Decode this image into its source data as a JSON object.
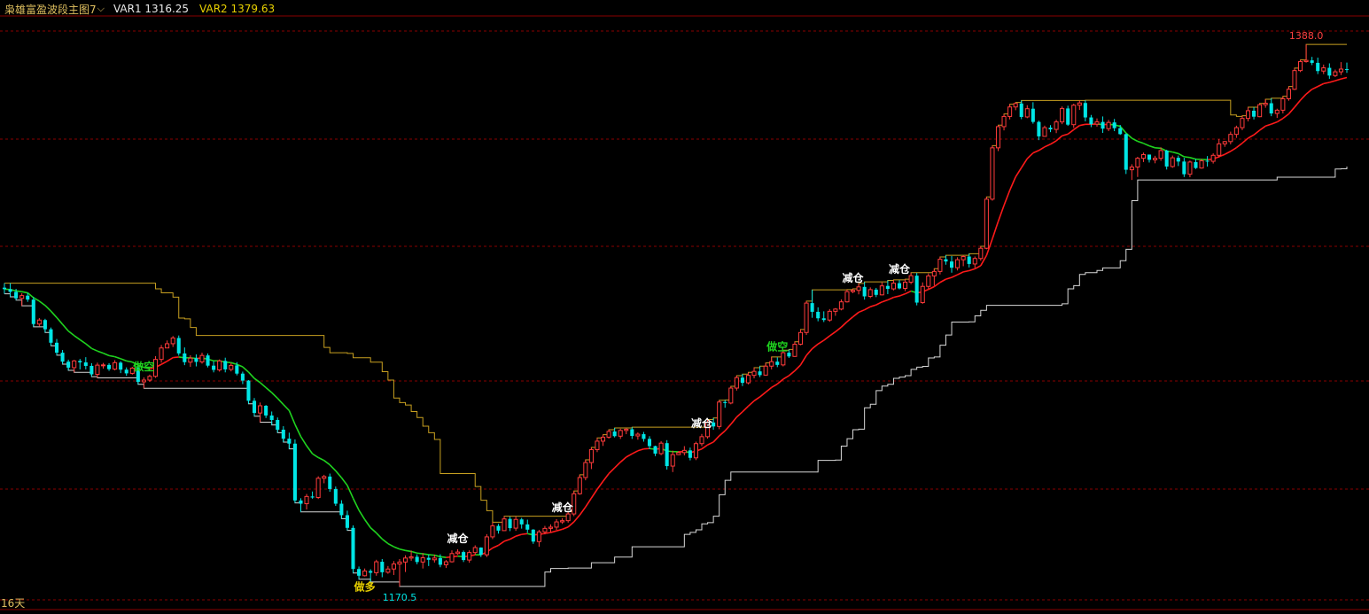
{
  "header": {
    "title": "枭雄富盈波段主图7",
    "chevron_icon": "chevron-down-icon",
    "var1_label": "VAR1 1316.25",
    "var2_label": "VAR2 1379.63"
  },
  "footer": {
    "period": "16天"
  },
  "colors": {
    "up": "#ff3b3b",
    "down": "#00e5e5",
    "ma": "#ff1a1a",
    "ma_green": "#1fd31f",
    "trail": "#c8a020",
    "support": "#d8d8d8",
    "grid": "#8a0000"
  },
  "chart_data": {
    "type": "candlestick",
    "y_range": [
      1163,
      1398
    ],
    "max_label": "1388.0",
    "min_label": "1170.5",
    "candles": [
      [
        1290.4,
        1292.2,
        1287.9,
        1289.8
      ],
      [
        1289.8,
        1292.2,
        1286.7,
        1288.7
      ],
      [
        1288.7,
        1289.9,
        1285.4,
        1286.1
      ],
      [
        1286.1,
        1288.2,
        1283.1,
        1287.2
      ],
      [
        1287.2,
        1288.3,
        1284.7,
        1285.6
      ],
      [
        1285.6,
        1286.6,
        1274.7,
        1275.8
      ],
      [
        1275.8,
        1278.2,
        1274.9,
        1277.4
      ],
      [
        1277.4,
        1277.9,
        1272.4,
        1273.7
      ],
      [
        1273.7,
        1274.4,
        1267.1,
        1268.3
      ],
      [
        1268.3,
        1269.8,
        1263.3,
        1264.3
      ],
      [
        1264.3,
        1265.4,
        1259.7,
        1260.7
      ],
      [
        1260.7,
        1261.5,
        1257.2,
        1258.3
      ],
      [
        1258.3,
        1261.4,
        1256.4,
        1261.0
      ],
      [
        1261.0,
        1261.8,
        1257.6,
        1260.4
      ],
      [
        1260.4,
        1262.5,
        1257.6,
        1259.0
      ],
      [
        1259.0,
        1260.1,
        1254.7,
        1255.6
      ],
      [
        1255.6,
        1260.3,
        1254.2,
        1259.3
      ],
      [
        1259.3,
        1260.2,
        1257.9,
        1259.4
      ],
      [
        1259.4,
        1260.1,
        1257.0,
        1257.7
      ],
      [
        1257.7,
        1261.3,
        1257.2,
        1260.3
      ],
      [
        1260.3,
        1260.9,
        1256.1,
        1257.5
      ],
      [
        1257.5,
        1258.4,
        1255.0,
        1256.0
      ],
      [
        1256.0,
        1258.6,
        1255.5,
        1258.1
      ],
      [
        1258.1,
        1259.0,
        1251.6,
        1252.6
      ],
      [
        1252.6,
        1254.4,
        1250.0,
        1253.3
      ],
      [
        1253.3,
        1255.5,
        1252.6,
        1254.8
      ],
      [
        1254.8,
        1262.9,
        1254.2,
        1261.6
      ],
      [
        1261.6,
        1267.4,
        1260.3,
        1266.2
      ],
      [
        1266.2,
        1269.2,
        1266.1,
        1267.9
      ],
      [
        1267.9,
        1271.0,
        1266.6,
        1270.2
      ],
      [
        1270.2,
        1271.2,
        1263.1,
        1264.0
      ],
      [
        1264.0,
        1266.4,
        1259.3,
        1260.5
      ],
      [
        1260.5,
        1263.3,
        1258.6,
        1262.1
      ],
      [
        1262.1,
        1263.6,
        1258.8,
        1260.6
      ],
      [
        1260.6,
        1264.3,
        1259.9,
        1263.2
      ],
      [
        1263.2,
        1264.0,
        1258.4,
        1259.1
      ],
      [
        1259.1,
        1260.9,
        1256.4,
        1257.4
      ],
      [
        1257.4,
        1261.6,
        1256.7,
        1261.0
      ],
      [
        1261.0,
        1262.3,
        1256.4,
        1257.6
      ],
      [
        1257.6,
        1260.2,
        1256.8,
        1259.2
      ],
      [
        1259.2,
        1260.5,
        1255.2,
        1255.9
      ],
      [
        1255.9,
        1256.7,
        1251.7,
        1253.1
      ],
      [
        1253.1,
        1253.3,
        1243.8,
        1245.0
      ],
      [
        1245.0,
        1246.1,
        1238.8,
        1240.1
      ],
      [
        1240.1,
        1244.3,
        1236.4,
        1243.0
      ],
      [
        1243.0,
        1243.3,
        1238.1,
        1239.1
      ],
      [
        1239.1,
        1240.7,
        1235.3,
        1237.3
      ],
      [
        1237.3,
        1238.3,
        1232.2,
        1233.4
      ],
      [
        1233.4,
        1234.8,
        1228.4,
        1229.8
      ],
      [
        1229.8,
        1232.2,
        1225.7,
        1227.8
      ],
      [
        1227.8,
        1229.5,
        1204.0,
        1205.0
      ],
      [
        1205.0,
        1205.9,
        1200.4,
        1203.7
      ],
      [
        1203.7,
        1207.6,
        1201.4,
        1206.6
      ],
      [
        1206.6,
        1208.6,
        1205.7,
        1206.2
      ],
      [
        1206.2,
        1214.7,
        1205.6,
        1213.9
      ],
      [
        1213.9,
        1215.3,
        1211.9,
        1214.6
      ],
      [
        1214.6,
        1215.8,
        1208.5,
        1209.6
      ],
      [
        1209.6,
        1210.6,
        1202.8,
        1203.7
      ],
      [
        1203.7,
        1205.1,
        1197.7,
        1199.1
      ],
      [
        1199.1,
        1200.9,
        1193.0,
        1194.0
      ],
      [
        1194.0,
        1195.0,
        1175.9,
        1177.5
      ],
      [
        1177.5,
        1178.5,
        1173.4,
        1174.8
      ],
      [
        1174.8,
        1177.7,
        1174.5,
        1176.7
      ],
      [
        1176.7,
        1177.4,
        1172.3,
        1176.0
      ],
      [
        1176.0,
        1181.2,
        1174.8,
        1180.4
      ],
      [
        1180.4,
        1181.5,
        1174.2,
        1176.2
      ],
      [
        1176.2,
        1178.7,
        1175.6,
        1177.5
      ],
      [
        1177.5,
        1180.7,
        1175.1,
        1179.5
      ],
      [
        1179.5,
        1181.5,
        1170.5,
        1180.3
      ],
      [
        1180.3,
        1183.0,
        1176.3,
        1181.9
      ],
      [
        1181.9,
        1184.9,
        1180.8,
        1182.4
      ],
      [
        1182.4,
        1183.4,
        1179.4,
        1180.3
      ],
      [
        1180.3,
        1183.9,
        1177.7,
        1182.0
      ],
      [
        1182.0,
        1183.3,
        1178.7,
        1181.2
      ],
      [
        1181.2,
        1183.3,
        1180.1,
        1181.9
      ],
      [
        1181.9,
        1183.4,
        1178.2,
        1179.2
      ],
      [
        1179.2,
        1181.1,
        1177.9,
        1180.4
      ],
      [
        1180.4,
        1185.0,
        1180.1,
        1183.7
      ],
      [
        1183.7,
        1185.4,
        1183.2,
        1184.3
      ],
      [
        1184.3,
        1184.9,
        1180.3,
        1181.1
      ],
      [
        1181.1,
        1185.0,
        1180.0,
        1184.1
      ],
      [
        1184.1,
        1187.0,
        1183.2,
        1186.1
      ],
      [
        1186.1,
        1186.2,
        1182.3,
        1183.2
      ],
      [
        1183.2,
        1191.5,
        1182.3,
        1190.4
      ],
      [
        1190.4,
        1196.3,
        1189.5,
        1194.8
      ],
      [
        1194.8,
        1195.6,
        1191.7,
        1192.9
      ],
      [
        1192.9,
        1198.7,
        1192.8,
        1197.6
      ],
      [
        1197.6,
        1198.5,
        1192.7,
        1193.9
      ],
      [
        1193.9,
        1198.6,
        1192.8,
        1197.4
      ],
      [
        1197.4,
        1198.0,
        1193.7,
        1195.4
      ],
      [
        1195.4,
        1197.3,
        1192.0,
        1193.3
      ],
      [
        1193.3,
        1193.5,
        1187.6,
        1188.5
      ],
      [
        1188.5,
        1193.2,
        1186.4,
        1192.4
      ],
      [
        1192.4,
        1194.8,
        1191.4,
        1193.8
      ],
      [
        1193.8,
        1195.4,
        1192.2,
        1194.3
      ],
      [
        1194.3,
        1197.5,
        1193.2,
        1196.4
      ],
      [
        1196.4,
        1197.9,
        1195.6,
        1196.9
      ],
      [
        1196.9,
        1200.5,
        1196.1,
        1199.6
      ],
      [
        1199.6,
        1208.8,
        1198.7,
        1207.7
      ],
      [
        1207.7,
        1215.3,
        1207.3,
        1214.2
      ],
      [
        1214.2,
        1221.3,
        1213.1,
        1220.2
      ],
      [
        1220.2,
        1226.3,
        1217.6,
        1225.4
      ],
      [
        1225.4,
        1230.1,
        1224.4,
        1228.8
      ],
      [
        1228.8,
        1231.4,
        1226.9,
        1230.4
      ],
      [
        1230.4,
        1233.4,
        1229.8,
        1232.7
      ],
      [
        1232.7,
        1234.1,
        1230.3,
        1230.8
      ],
      [
        1230.8,
        1233.8,
        1229.7,
        1233.1
      ],
      [
        1233.1,
        1233.9,
        1231.6,
        1233.6
      ],
      [
        1233.6,
        1234.4,
        1229.7,
        1230.9
      ],
      [
        1230.9,
        1232.3,
        1229.4,
        1231.6
      ],
      [
        1231.6,
        1232.5,
        1228.6,
        1229.7
      ],
      [
        1229.7,
        1230.8,
        1225.6,
        1226.8
      ],
      [
        1226.8,
        1227.0,
        1222.8,
        1223.8
      ],
      [
        1223.8,
        1228.8,
        1223.2,
        1228.0
      ],
      [
        1228.0,
        1229.2,
        1217.4,
        1218.8
      ],
      [
        1218.8,
        1225.0,
        1216.4,
        1223.4
      ],
      [
        1223.4,
        1224.7,
        1223.2,
        1224.2
      ],
      [
        1224.2,
        1226.8,
        1223.1,
        1225.1
      ],
      [
        1225.1,
        1226.2,
        1221.1,
        1222.1
      ],
      [
        1222.1,
        1228.6,
        1221.2,
        1227.8
      ],
      [
        1227.8,
        1231.7,
        1226.8,
        1230.6
      ],
      [
        1230.6,
        1237.5,
        1229.8,
        1236.3
      ],
      [
        1236.3,
        1238.1,
        1233.4,
        1234.7
      ],
      [
        1234.7,
        1245.2,
        1233.6,
        1244.5
      ],
      [
        1244.5,
        1245.3,
        1242.2,
        1244.1
      ],
      [
        1244.1,
        1250.8,
        1243.6,
        1250.1
      ],
      [
        1250.1,
        1255.1,
        1249.1,
        1254.3
      ],
      [
        1254.3,
        1255.7,
        1250.9,
        1252.2
      ],
      [
        1252.2,
        1256.4,
        1251.6,
        1255.2
      ],
      [
        1255.2,
        1258.3,
        1254.0,
        1256.8
      ],
      [
        1256.8,
        1258.9,
        1254.5,
        1255.3
      ],
      [
        1255.3,
        1260.2,
        1255.1,
        1258.9
      ],
      [
        1258.9,
        1262.6,
        1257.6,
        1260.7
      ],
      [
        1260.7,
        1262.4,
        1258.5,
        1259.4
      ],
      [
        1259.4,
        1265.3,
        1258.8,
        1264.3
      ],
      [
        1264.3,
        1265.6,
        1262.2,
        1262.8
      ],
      [
        1262.8,
        1268.7,
        1262.6,
        1267.7
      ],
      [
        1267.7,
        1273.6,
        1267.3,
        1272.4
      ],
      [
        1272.4,
        1285.0,
        1271.4,
        1284.2
      ],
      [
        1284.2,
        1289.5,
        1278.3,
        1280.7
      ],
      [
        1280.7,
        1282.5,
        1276.9,
        1278.1
      ],
      [
        1278.1,
        1280.9,
        1276.6,
        1277.4
      ],
      [
        1277.4,
        1281.8,
        1276.7,
        1280.9
      ],
      [
        1280.9,
        1282.2,
        1279.1,
        1281.8
      ],
      [
        1281.8,
        1285.7,
        1281.3,
        1284.7
      ],
      [
        1284.7,
        1289.6,
        1284.4,
        1288.8
      ],
      [
        1288.8,
        1289.9,
        1288.2,
        1289.3
      ],
      [
        1289.3,
        1292.1,
        1287.7,
        1290.7
      ],
      [
        1290.7,
        1292.7,
        1285.6,
        1286.9
      ],
      [
        1286.9,
        1290.5,
        1286.2,
        1289.6
      ],
      [
        1289.6,
        1290.3,
        1286.6,
        1287.5
      ],
      [
        1287.5,
        1292.5,
        1287.3,
        1291.1
      ],
      [
        1291.1,
        1293.3,
        1287.8,
        1289.9
      ],
      [
        1289.9,
        1293.5,
        1289.3,
        1292.2
      ],
      [
        1292.2,
        1293.4,
        1289.7,
        1290.1
      ],
      [
        1290.1,
        1293.8,
        1289.0,
        1292.6
      ],
      [
        1292.6,
        1296.4,
        1291.8,
        1295.2
      ],
      [
        1295.2,
        1296.3,
        1283.3,
        1284.4
      ],
      [
        1284.4,
        1292.5,
        1283.9,
        1290.9
      ],
      [
        1290.9,
        1296.1,
        1289.9,
        1295.1
      ],
      [
        1295.1,
        1298.0,
        1291.2,
        1296.9
      ],
      [
        1296.9,
        1302.7,
        1295.7,
        1301.8
      ],
      [
        1301.8,
        1303.4,
        1299.6,
        1300.9
      ],
      [
        1300.9,
        1303.1,
        1296.4,
        1298.4
      ],
      [
        1298.4,
        1302.6,
        1297.3,
        1301.6
      ],
      [
        1301.6,
        1303.4,
        1299.0,
        1302.9
      ],
      [
        1302.9,
        1304.0,
        1298.5,
        1299.9
      ],
      [
        1299.9,
        1302.9,
        1298.3,
        1302.1
      ],
      [
        1302.1,
        1307.0,
        1301.2,
        1306.2
      ],
      [
        1306.2,
        1326.8,
        1305.8,
        1325.9
      ],
      [
        1325.9,
        1347.4,
        1325.3,
        1346.5
      ],
      [
        1346.5,
        1355.6,
        1345.2,
        1355.0
      ],
      [
        1355.0,
        1360.1,
        1353.5,
        1359.1
      ],
      [
        1359.1,
        1364.0,
        1357.9,
        1362.9
      ],
      [
        1362.9,
        1364.7,
        1361.6,
        1364.3
      ],
      [
        1364.3,
        1365.5,
        1358.0,
        1358.9
      ],
      [
        1358.9,
        1363.6,
        1358.4,
        1362.2
      ],
      [
        1362.2,
        1364.8,
        1356.2,
        1356.9
      ],
      [
        1356.9,
        1357.4,
        1349.6,
        1351.1
      ],
      [
        1351.1,
        1355.4,
        1350.9,
        1354.6
      ],
      [
        1354.6,
        1355.6,
        1352.8,
        1353.9
      ],
      [
        1353.9,
        1357.8,
        1352.4,
        1356.9
      ],
      [
        1356.9,
        1363.1,
        1356.0,
        1362.3
      ],
      [
        1362.3,
        1363.4,
        1355.3,
        1355.8
      ],
      [
        1355.8,
        1364.2,
        1354.5,
        1363.6
      ],
      [
        1363.6,
        1365.5,
        1361.7,
        1364.5
      ],
      [
        1364.5,
        1365.6,
        1357.1,
        1358.7
      ],
      [
        1358.7,
        1359.7,
        1354.8,
        1356.0
      ],
      [
        1356.0,
        1358.3,
        1355.0,
        1356.9
      ],
      [
        1356.9,
        1359.1,
        1352.5,
        1354.2
      ],
      [
        1354.2,
        1357.7,
        1353.2,
        1356.7
      ],
      [
        1356.7,
        1358.1,
        1353.2,
        1354.4
      ],
      [
        1354.4,
        1355.7,
        1351.7,
        1352.0
      ],
      [
        1352.0,
        1352.3,
        1336.0,
        1337.7
      ],
      [
        1337.7,
        1339.9,
        1333.6,
        1338.8
      ],
      [
        1338.8,
        1342.9,
        1334.8,
        1342.3
      ],
      [
        1342.3,
        1344.6,
        1340.8,
        1343.8
      ],
      [
        1343.8,
        1343.8,
        1340.6,
        1341.7
      ],
      [
        1341.7,
        1343.3,
        1340.3,
        1342.3
      ],
      [
        1342.3,
        1346.7,
        1341.3,
        1345.4
      ],
      [
        1345.4,
        1345.7,
        1337.8,
        1339.0
      ],
      [
        1339.0,
        1343.4,
        1338.5,
        1342.5
      ],
      [
        1342.5,
        1343.4,
        1339.2,
        1341.0
      ],
      [
        1341.0,
        1342.5,
        1334.8,
        1335.9
      ],
      [
        1335.9,
        1341.4,
        1334.7,
        1340.8
      ],
      [
        1340.8,
        1342.0,
        1338.0,
        1338.4
      ],
      [
        1338.4,
        1342.1,
        1338.1,
        1341.3
      ],
      [
        1341.3,
        1343.2,
        1339.0,
        1341.1
      ],
      [
        1341.1,
        1344.3,
        1340.2,
        1343.5
      ],
      [
        1343.5,
        1350.0,
        1342.6,
        1348.1
      ],
      [
        1348.1,
        1349.3,
        1346.9,
        1349.0
      ],
      [
        1349.0,
        1353.0,
        1347.9,
        1351.9
      ],
      [
        1351.9,
        1355.4,
        1350.5,
        1354.6
      ],
      [
        1354.6,
        1359.4,
        1353.6,
        1358.3
      ],
      [
        1358.3,
        1362.8,
        1357.1,
        1361.4
      ],
      [
        1361.4,
        1362.8,
        1357.9,
        1359.0
      ],
      [
        1359.0,
        1364.3,
        1358.8,
        1363.8
      ],
      [
        1363.8,
        1366.0,
        1362.6,
        1364.4
      ],
      [
        1364.4,
        1366.4,
        1359.2,
        1360.3
      ],
      [
        1360.3,
        1362.2,
        1358.5,
        1361.6
      ],
      [
        1361.6,
        1367.2,
        1360.3,
        1366.2
      ],
      [
        1366.2,
        1371.1,
        1365.4,
        1370.0
      ],
      [
        1370.0,
        1378.5,
        1369.7,
        1377.5
      ],
      [
        1377.5,
        1381.8,
        1376.9,
        1381.1
      ],
      [
        1381.1,
        1388.0,
        1380.7,
        1381.6
      ],
      [
        1381.6,
        1383.0,
        1379.7,
        1380.6
      ],
      [
        1380.6,
        1382.7,
        1376.1,
        1377.3
      ],
      [
        1377.3,
        1379.9,
        1376.1,
        1378.6
      ],
      [
        1378.6,
        1380.4,
        1374.2,
        1375.5
      ],
      [
        1375.5,
        1377.9,
        1374.9,
        1377.0
      ],
      [
        1377.0,
        1380.9,
        1375.7,
        1378.1
      ],
      [
        1378.1,
        1380.7,
        1376.6,
        1377.9
      ]
    ]
  },
  "annotations": [
    {
      "text": "做空",
      "color": "#1fd31f",
      "index": 24
    },
    {
      "text": "减仓",
      "color": "#ffffff",
      "index": 78
    },
    {
      "text": "做多",
      "color": "#e8d000",
      "index": 62
    },
    {
      "text": "减仓",
      "color": "#ffffff",
      "index": 96
    },
    {
      "text": "减仓",
      "color": "#ffffff",
      "index": 120
    },
    {
      "text": "做空",
      "color": "#1fd31f",
      "index": 133
    },
    {
      "text": "减仓",
      "color": "#ffffff",
      "index": 146
    },
    {
      "text": "减仓",
      "color": "#ffffff",
      "index": 154
    }
  ]
}
